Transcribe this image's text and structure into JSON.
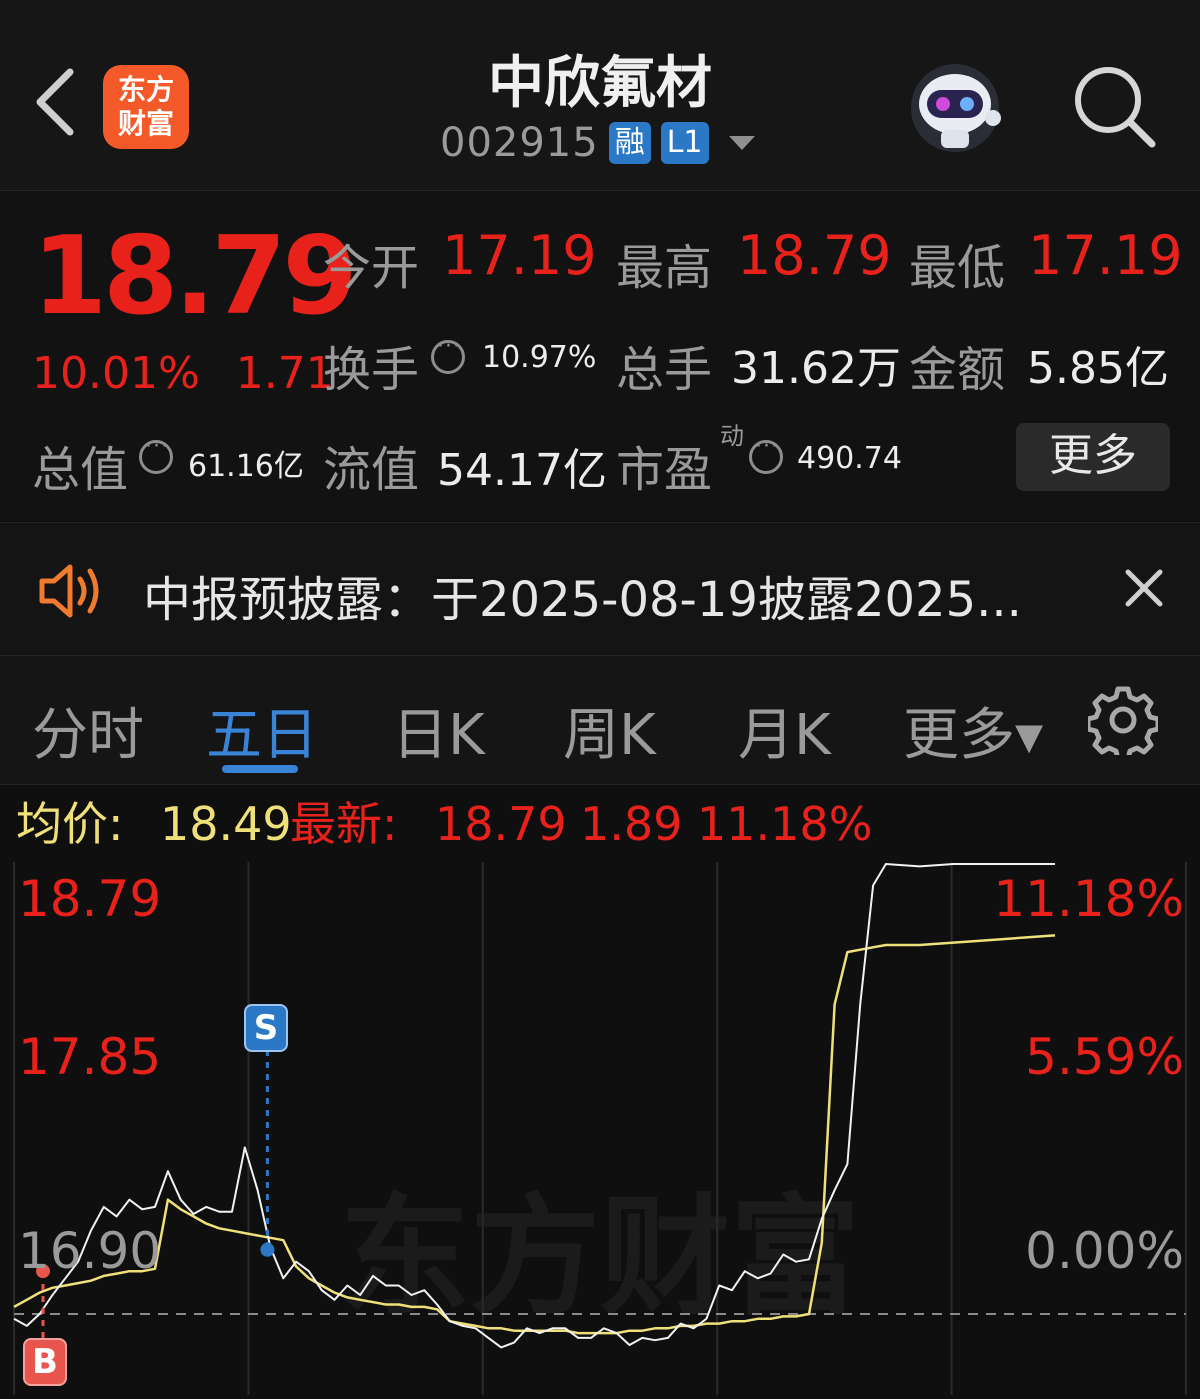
{
  "header": {
    "logo_line1": "东方",
    "logo_line2": "财富",
    "title": "中欣氟材",
    "code": "002915",
    "tag_margin": "融",
    "tag_level": "L1"
  },
  "quote": {
    "price": "18.79",
    "change_pct": "10.01%",
    "change_amt": "1.71",
    "open_label": "今开",
    "open_value": "17.19",
    "high_label": "最高",
    "high_value": "18.79",
    "low_label": "最低",
    "low_value": "17.19",
    "turnover_label": "换手",
    "turnover_value": "10.97%",
    "volume_label": "总手",
    "volume_value": "31.62万",
    "amount_label": "金额",
    "amount_value": "5.85亿",
    "total_cap_label": "总值",
    "total_cap_value": "61.16亿",
    "float_cap_label": "流值",
    "float_cap_value": "54.17亿",
    "pe_label": "市盈",
    "pe_superscript": "动",
    "pe_value": "490.74",
    "more_button": "更多"
  },
  "notice": {
    "text": "中报预披露：于2025-08-19披露2025..."
  },
  "tabs": [
    {
      "label": "分时",
      "active": false
    },
    {
      "label": "五日",
      "active": true
    },
    {
      "label": "日K",
      "active": false
    },
    {
      "label": "周K",
      "active": false
    },
    {
      "label": "月K",
      "active": false
    },
    {
      "label": "更多▾",
      "active": false
    }
  ],
  "infobar": {
    "avg_label": "均价:",
    "avg_value": "18.49",
    "latest_label": "最新:",
    "latest_value": "18.79",
    "latest_change": "1.89",
    "latest_pct": "11.18%"
  },
  "colors": {
    "up": "#e8221b",
    "price_line": "#f2f2f2",
    "avg_line": "#f0e07a",
    "accent": "#3a84d8"
  },
  "chart_data": {
    "type": "line",
    "y_left_labels": [
      "18.79",
      "17.85",
      "16.90"
    ],
    "y_right_labels": [
      "11.18%",
      "5.59%",
      "0.00%"
    ],
    "ylim": [
      16.56,
      18.79
    ],
    "days": 5,
    "watermark": "东方财富",
    "markers": [
      {
        "label": "B",
        "day": 1,
        "price": 17.08
      },
      {
        "label": "S",
        "day": 2,
        "price": 17.17
      }
    ],
    "series": [
      {
        "role": "price",
        "values": [
          16.88,
          16.85,
          16.9,
          16.98,
          17.05,
          17.12,
          17.25,
          17.35,
          17.31,
          17.38,
          17.34,
          17.35,
          17.5,
          17.38,
          17.32,
          17.35,
          17.33,
          17.33,
          17.6,
          17.42,
          17.18,
          17.05,
          17.12,
          17.08,
          17.0,
          16.96,
          17.02,
          16.98,
          17.06,
          17.02,
          17.02,
          16.98,
          17.0,
          16.94,
          16.87,
          16.85,
          16.84,
          16.8,
          16.76,
          16.78,
          16.84,
          16.82,
          16.84,
          16.84,
          16.8,
          16.8,
          16.84,
          16.82,
          16.77,
          16.8,
          16.79,
          16.8,
          16.86,
          16.84,
          16.88,
          17.02,
          17.0,
          17.08,
          17.05,
          17.07,
          17.15,
          17.12,
          17.13,
          17.3,
          17.42,
          17.53,
          18.2,
          18.7,
          18.79,
          18.78,
          18.79,
          18.79,
          18.79,
          18.79
        ]
      },
      {
        "role": "average",
        "values": [
          16.93,
          16.96,
          16.99,
          17.01,
          17.02,
          17.03,
          17.04,
          17.06,
          17.07,
          17.08,
          17.08,
          17.09,
          17.38,
          17.34,
          17.31,
          17.28,
          17.26,
          17.25,
          17.24,
          17.23,
          17.22,
          17.21,
          17.1,
          17.05,
          17.02,
          16.99,
          16.97,
          16.96,
          16.95,
          16.94,
          16.94,
          16.93,
          16.93,
          16.92,
          16.87,
          16.86,
          16.85,
          16.84,
          16.84,
          16.83,
          16.83,
          16.83,
          16.83,
          16.83,
          16.82,
          16.82,
          16.82,
          16.82,
          16.83,
          16.83,
          16.84,
          16.84,
          16.85,
          16.85,
          16.86,
          16.86,
          16.87,
          16.87,
          16.88,
          16.88,
          16.89,
          16.89,
          16.9,
          17.2,
          18.2,
          18.42,
          18.43,
          18.44,
          18.45,
          18.45,
          18.46,
          18.47,
          18.48,
          18.49
        ]
      }
    ]
  }
}
